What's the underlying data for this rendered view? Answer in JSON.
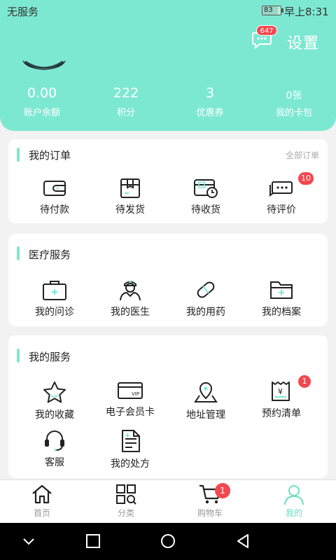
{
  "status_bar": {
    "carrier": "无服务",
    "battery": "83",
    "time": "早上8:31"
  },
  "header": {
    "message_badge": "647",
    "settings_label": "设置",
    "stats": [
      {
        "value": "0.00",
        "label": "账户余额"
      },
      {
        "value": "222",
        "label": "积分"
      },
      {
        "value": "3",
        "label": "优惠券"
      },
      {
        "value": "0张",
        "label": "我的卡包"
      }
    ]
  },
  "orders": {
    "title": "我的订单",
    "all_label": "全部订单",
    "items": [
      {
        "label": "待付款",
        "icon": "wallet-icon"
      },
      {
        "label": "待发货",
        "icon": "package-icon"
      },
      {
        "label": "待收货",
        "icon": "delivery-clock-icon"
      },
      {
        "label": "待评价",
        "icon": "review-icon",
        "badge": "10"
      }
    ]
  },
  "medical": {
    "title": "医疗服务",
    "items": [
      {
        "label": "我的问诊",
        "icon": "medical-kit-icon"
      },
      {
        "label": "我的医生",
        "icon": "doctor-icon"
      },
      {
        "label": "我的用药",
        "icon": "pill-icon"
      },
      {
        "label": "我的档案",
        "icon": "folder-icon"
      }
    ]
  },
  "services": {
    "title": "我的服务",
    "items": [
      {
        "label": "我的收藏",
        "icon": "star-icon"
      },
      {
        "label": "电子会员卡",
        "icon": "vip-card-icon"
      },
      {
        "label": "地址管理",
        "icon": "location-icon"
      },
      {
        "label": "预约清单",
        "icon": "receipt-icon",
        "badge": "1"
      },
      {
        "label": "客服",
        "icon": "headset-icon"
      },
      {
        "label": "我的处方",
        "icon": "prescription-icon"
      }
    ],
    "vip_text": "VIP",
    "receipt_text": "¥"
  },
  "bottom_nav": {
    "items": [
      {
        "label": "首页",
        "icon": "home-icon"
      },
      {
        "label": "分类",
        "icon": "category-icon"
      },
      {
        "label": "购物车",
        "icon": "cart-icon",
        "badge": "1"
      },
      {
        "label": "我的",
        "icon": "user-icon",
        "active": true
      }
    ]
  },
  "colors": {
    "accent": "#7de8d2",
    "badge": "#f2484f",
    "active_tab": "#6fdcc5"
  }
}
